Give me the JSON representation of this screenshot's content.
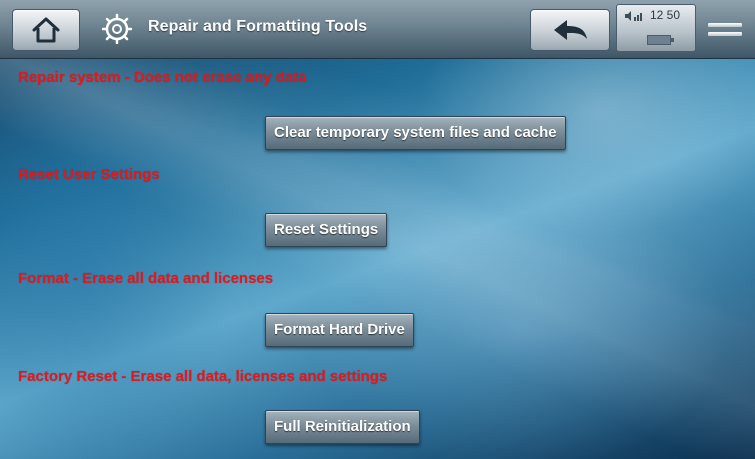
{
  "header": {
    "title": "Repair and Formatting Tools",
    "clock": "12 50",
    "icons": {
      "home": "home-icon",
      "title": "repair-tools-icon",
      "back": "back-arrow-icon",
      "volume": "volume-icon",
      "battery": "battery-icon",
      "menu": "menu-icon"
    }
  },
  "sections": [
    {
      "heading": "Repair system - Does not erase any data",
      "button": "Clear temporary system files and cache"
    },
    {
      "heading": "Reset User Settings",
      "button": "Reset Settings"
    },
    {
      "heading": "Format - Erase all data and licenses",
      "button": "Format Hard Drive"
    },
    {
      "heading": "Factory Reset - Erase all data, licenses and settings",
      "button": "Full Reinitialization"
    }
  ],
  "colors": {
    "heading_text": "#e3181a",
    "title_text": "#ffffff"
  }
}
